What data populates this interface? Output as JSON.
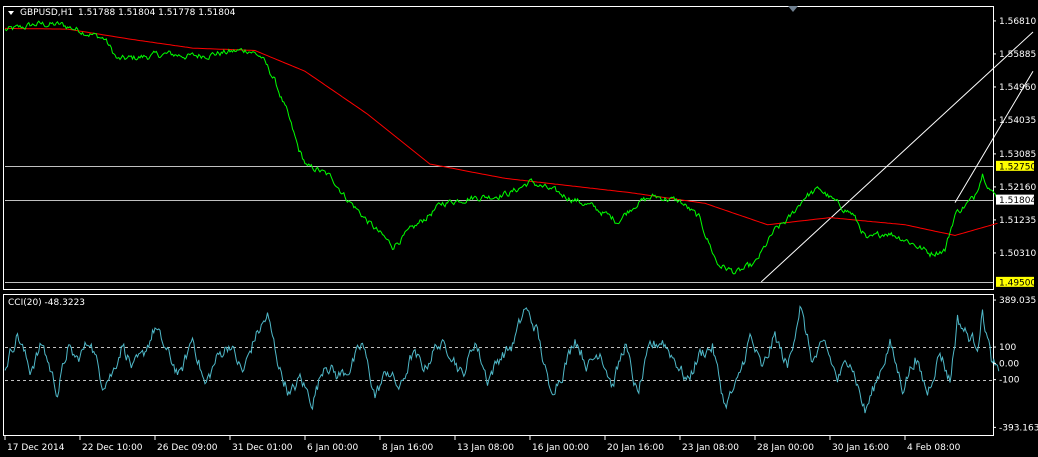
{
  "header": {
    "symbol": "GBPUSD,H1",
    "ohlc": "1.51788 1.51804 1.51778 1.51804"
  },
  "cci_header": {
    "label": "CCI(20) -48.3223"
  },
  "colors": {
    "background": "#000000",
    "price_line": "#00ff00",
    "moving_average": "#ff0000",
    "cci_line": "#4fb8c8",
    "frame": "#ffffff",
    "tag_background": "#ffff00"
  },
  "chart_data": [
    {
      "type": "line",
      "panel": "price",
      "y_ticks": [
        "1.56810",
        "1.55885",
        "1.54960",
        "1.54035",
        "1.53085",
        "1.52160",
        "1.51235",
        "1.50310"
      ],
      "y_tick_values": [
        1.5681,
        1.55885,
        1.5496,
        1.54035,
        1.53085,
        1.5216,
        1.51235,
        1.5031
      ],
      "ylim": [
        1.493,
        1.572
      ],
      "x_ticks": [
        "17 Dec 2014",
        "22 Dec 10:00",
        "26 Dec 09:00",
        "31 Dec 01:00",
        "6 Jan 00:00",
        "8 Jan 16:00",
        "13 Jan 08:00",
        "16 Jan 00:00",
        "20 Jan 16:00",
        "23 Jan 08:00",
        "28 Jan 00:00",
        "30 Jan 16:00",
        "4 Feb 08:00"
      ],
      "x_tick_index": [
        0,
        60,
        120,
        180,
        240,
        300,
        360,
        420,
        480,
        540,
        600,
        660,
        720
      ],
      "n_bars": 765,
      "price_anchors": [
        [
          0,
          1.5655
        ],
        [
          10,
          1.566
        ],
        [
          25,
          1.5672
        ],
        [
          45,
          1.567
        ],
        [
          60,
          1.5655
        ],
        [
          80,
          1.563
        ],
        [
          90,
          1.5572
        ],
        [
          110,
          1.558
        ],
        [
          130,
          1.5588
        ],
        [
          150,
          1.5582
        ],
        [
          175,
          1.5592
        ],
        [
          195,
          1.56
        ],
        [
          205,
          1.558
        ],
        [
          215,
          1.552
        ],
        [
          225,
          1.543
        ],
        [
          235,
          1.532
        ],
        [
          242,
          1.527
        ],
        [
          250,
          1.5265
        ],
        [
          262,
          1.524
        ],
        [
          272,
          1.519
        ],
        [
          290,
          1.512
        ],
        [
          310,
          1.505
        ],
        [
          330,
          1.511
        ],
        [
          350,
          1.517
        ],
        [
          370,
          1.5185
        ],
        [
          390,
          1.519
        ],
        [
          405,
          1.52
        ],
        [
          420,
          1.523
        ],
        [
          438,
          1.5205
        ],
        [
          452,
          1.5185
        ],
        [
          470,
          1.516
        ],
        [
          490,
          1.512
        ],
        [
          505,
          1.517
        ],
        [
          520,
          1.519
        ],
        [
          540,
          1.5175
        ],
        [
          555,
          1.513
        ],
        [
          570,
          1.5
        ],
        [
          585,
          1.4975
        ],
        [
          600,
          1.5
        ],
        [
          615,
          1.509
        ],
        [
          628,
          1.513
        ],
        [
          640,
          1.519
        ],
        [
          652,
          1.521
        ],
        [
          665,
          1.517
        ],
        [
          678,
          1.514
        ],
        [
          690,
          1.5065
        ],
        [
          705,
          1.509
        ],
        [
          720,
          1.507
        ],
        [
          740,
          1.503
        ],
        [
          752,
          1.504
        ],
        [
          760,
          1.514
        ],
        [
          775,
          1.5185
        ],
        [
          782,
          1.5255
        ],
        [
          790,
          1.52
        ],
        [
          795,
          1.51804
        ]
      ],
      "moving_average_anchors": [
        [
          0,
          1.566
        ],
        [
          50,
          1.5658
        ],
        [
          100,
          1.563
        ],
        [
          150,
          1.5605
        ],
        [
          200,
          1.5598
        ],
        [
          240,
          1.554
        ],
        [
          290,
          1.542
        ],
        [
          340,
          1.528
        ],
        [
          400,
          1.524
        ],
        [
          450,
          1.522
        ],
        [
          500,
          1.52
        ],
        [
          560,
          1.517
        ],
        [
          610,
          1.511
        ],
        [
          660,
          1.513
        ],
        [
          720,
          1.511
        ],
        [
          760,
          1.508
        ],
        [
          795,
          1.5115
        ]
      ],
      "horizontal_levels": [
        {
          "value": 1.5275,
          "label": "1.52750"
        },
        {
          "value": 1.51804,
          "label": "1.51804"
        },
        {
          "value": 1.495,
          "label": "1.49500"
        }
      ],
      "trend_channel": {
        "line1": [
          [
            605,
            1.495
          ],
          [
            1033,
            1.565
          ]
        ],
        "line2": [
          [
            760,
            1.5172
          ],
          [
            1033,
            1.554
          ]
        ]
      }
    },
    {
      "type": "line",
      "panel": "cci",
      "indicator": "CCI(20)",
      "y_ticks": [
        "389.035",
        "100",
        "0.00",
        "-100",
        "-393.163"
      ],
      "y_tick_values": [
        389.035,
        100,
        0,
        -100,
        -393.163
      ],
      "ylim": [
        -440,
        420
      ],
      "levels": [
        100,
        -100
      ],
      "last_value": -48.3223,
      "cci_anchors": [
        [
          0,
          -20
        ],
        [
          10,
          180
        ],
        [
          20,
          -40
        ],
        [
          30,
          120
        ],
        [
          42,
          -180
        ],
        [
          50,
          90
        ],
        [
          58,
          20
        ],
        [
          68,
          150
        ],
        [
          78,
          -120
        ],
        [
          86,
          -60
        ],
        [
          94,
          120
        ],
        [
          102,
          -30
        ],
        [
          110,
          40
        ],
        [
          120,
          220
        ],
        [
          130,
          60
        ],
        [
          140,
          -80
        ],
        [
          150,
          160
        ],
        [
          160,
          -140
        ],
        [
          170,
          40
        ],
        [
          180,
          120
        ],
        [
          190,
          -60
        ],
        [
          200,
          160
        ],
        [
          210,
          290
        ],
        [
          220,
          -40
        ],
        [
          228,
          -200
        ],
        [
          236,
          -90
        ],
        [
          246,
          -240
        ],
        [
          256,
          10
        ],
        [
          266,
          -80
        ],
        [
          276,
          -30
        ],
        [
          286,
          120
        ],
        [
          296,
          -200
        ],
        [
          306,
          -40
        ],
        [
          316,
          -160
        ],
        [
          326,
          60
        ],
        [
          336,
          -30
        ],
        [
          346,
          120
        ],
        [
          356,
          80
        ],
        [
          366,
          -80
        ],
        [
          376,
          140
        ],
        [
          386,
          -100
        ],
        [
          396,
          40
        ],
        [
          406,
          110
        ],
        [
          416,
          340
        ],
        [
          426,
          190
        ],
        [
          436,
          -180
        ],
        [
          446,
          -60
        ],
        [
          456,
          160
        ],
        [
          466,
          -20
        ],
        [
          476,
          80
        ],
        [
          486,
          -140
        ],
        [
          496,
          120
        ],
        [
          506,
          -200
        ],
        [
          516,
          100
        ],
        [
          526,
          140
        ],
        [
          536,
          20
        ],
        [
          546,
          -110
        ],
        [
          556,
          60
        ],
        [
          566,
          100
        ],
        [
          576,
          -260
        ],
        [
          586,
          -120
        ],
        [
          596,
          160
        ],
        [
          606,
          -40
        ],
        [
          616,
          170
        ],
        [
          626,
          -30
        ],
        [
          636,
          350
        ],
        [
          646,
          10
        ],
        [
          656,
          120
        ],
        [
          666,
          -100
        ],
        [
          676,
          40
        ],
        [
          688,
          -300
        ],
        [
          698,
          -90
        ],
        [
          708,
          120
        ],
        [
          718,
          -150
        ],
        [
          728,
          30
        ],
        [
          738,
          -180
        ],
        [
          748,
          70
        ],
        [
          756,
          -110
        ],
        [
          762,
          270
        ],
        [
          770,
          170
        ],
        [
          778,
          120
        ],
        [
          782,
          310
        ],
        [
          790,
          -10
        ],
        [
          795,
          -48
        ]
      ]
    }
  ]
}
